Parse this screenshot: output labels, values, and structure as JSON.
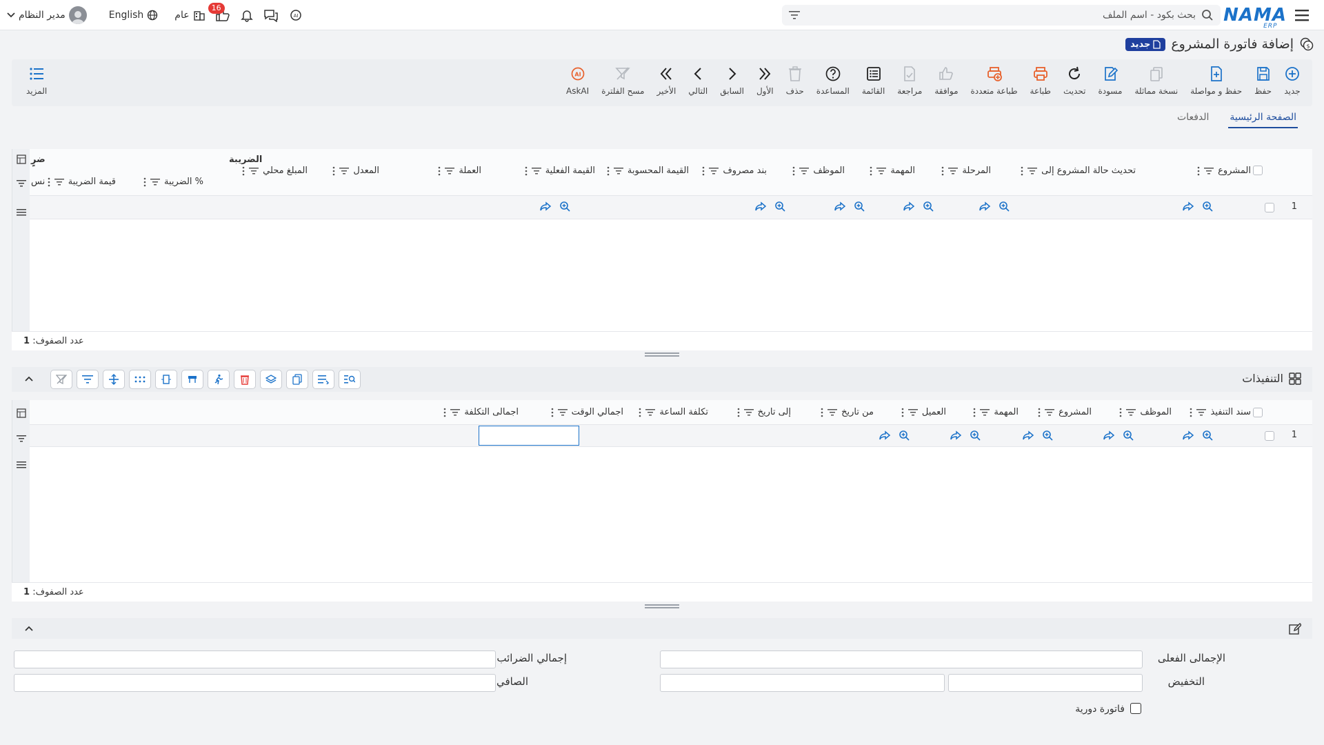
{
  "topbar": {
    "brand": "NAMA",
    "brand_sub": "ERP",
    "search_placeholder": "بحث بكود - اسم الملف",
    "language": "English",
    "scope": "عام",
    "notif_count": "16",
    "user": "مدير النظام"
  },
  "page": {
    "title": "إضافة فاتورة المشروع",
    "status_badge": "جديد"
  },
  "toolbar": {
    "items": [
      {
        "label": "جديد",
        "icon": "plus-circle-icon"
      },
      {
        "label": "حفظ",
        "icon": "save-icon"
      },
      {
        "label": "حفظ و مواصلة",
        "icon": "save-continue-icon"
      },
      {
        "label": "نسخة مماثلة",
        "icon": "copy-icon"
      },
      {
        "label": "مسودة",
        "icon": "draft-icon"
      },
      {
        "label": "تحديث",
        "icon": "refresh-icon"
      },
      {
        "label": "طباعة",
        "icon": "print-icon"
      },
      {
        "label": "طباعة متعددة",
        "icon": "multi-print-icon"
      },
      {
        "label": "موافقة",
        "icon": "thumbs-up-icon"
      },
      {
        "label": "مراجعة",
        "icon": "review-icon"
      },
      {
        "label": "القائمة",
        "icon": "list-icon"
      },
      {
        "label": "المساعدة",
        "icon": "help-icon"
      },
      {
        "label": "حذف",
        "icon": "trash-icon"
      },
      {
        "label": "الأول",
        "icon": "first-icon"
      },
      {
        "label": "السابق",
        "icon": "prev-icon"
      },
      {
        "label": "التالي",
        "icon": "next-icon"
      },
      {
        "label": "الأخير",
        "icon": "last-icon"
      },
      {
        "label": "مسح الفلترة",
        "icon": "clear-filter-icon"
      },
      {
        "label": "AskAI",
        "icon": "ask-ai-icon"
      }
    ],
    "more_label": "المزيد"
  },
  "tabs": [
    {
      "label": "الصفحة الرئيسية",
      "active": true
    },
    {
      "label": "الدفعات",
      "active": false
    }
  ],
  "grid1": {
    "group_header": "الضريبة",
    "columns": [
      "المشروع",
      "تحديث حالة المشروع إلى",
      "المرحلة",
      "المهمة",
      "الموظف",
      "بند مصروف",
      "القيمة المحسوبة",
      "القيمة الفعلية",
      "العملة",
      "المعدل",
      "المبلغ محلي"
    ],
    "tax_columns": [
      "% الضريبة",
      "قيمة الضريبة",
      "نس"
    ],
    "cut_header": "ضرٍ",
    "row_number": "1",
    "row_count_label": "عدد الصفوف:",
    "row_count": "1"
  },
  "section2": {
    "title": "التنفيذات"
  },
  "grid2": {
    "columns": [
      "سند التنفيذ",
      "الموظف",
      "المشروع",
      "المهمة",
      "العميل",
      "من تاريخ",
      "إلى تاريخ",
      "تكلفة الساعة",
      "اجمالي الوقت",
      "اجمالى التكلفة"
    ],
    "row_number": "1",
    "row_count_label": "عدد الصفوف:",
    "row_count": "1"
  },
  "totals": {
    "actual_total_label": "الإجمالى الفعلى",
    "tax_total_label": "إجمالي الضرائب",
    "discount_label": "التخفيض",
    "net_label": "الصافي",
    "recurring_label": "فاتورة دورية"
  },
  "colors": {
    "accent": "#1b72c9",
    "title_badge": "#1f3f9e",
    "danger": "#e53935",
    "print": "#e8612c"
  }
}
